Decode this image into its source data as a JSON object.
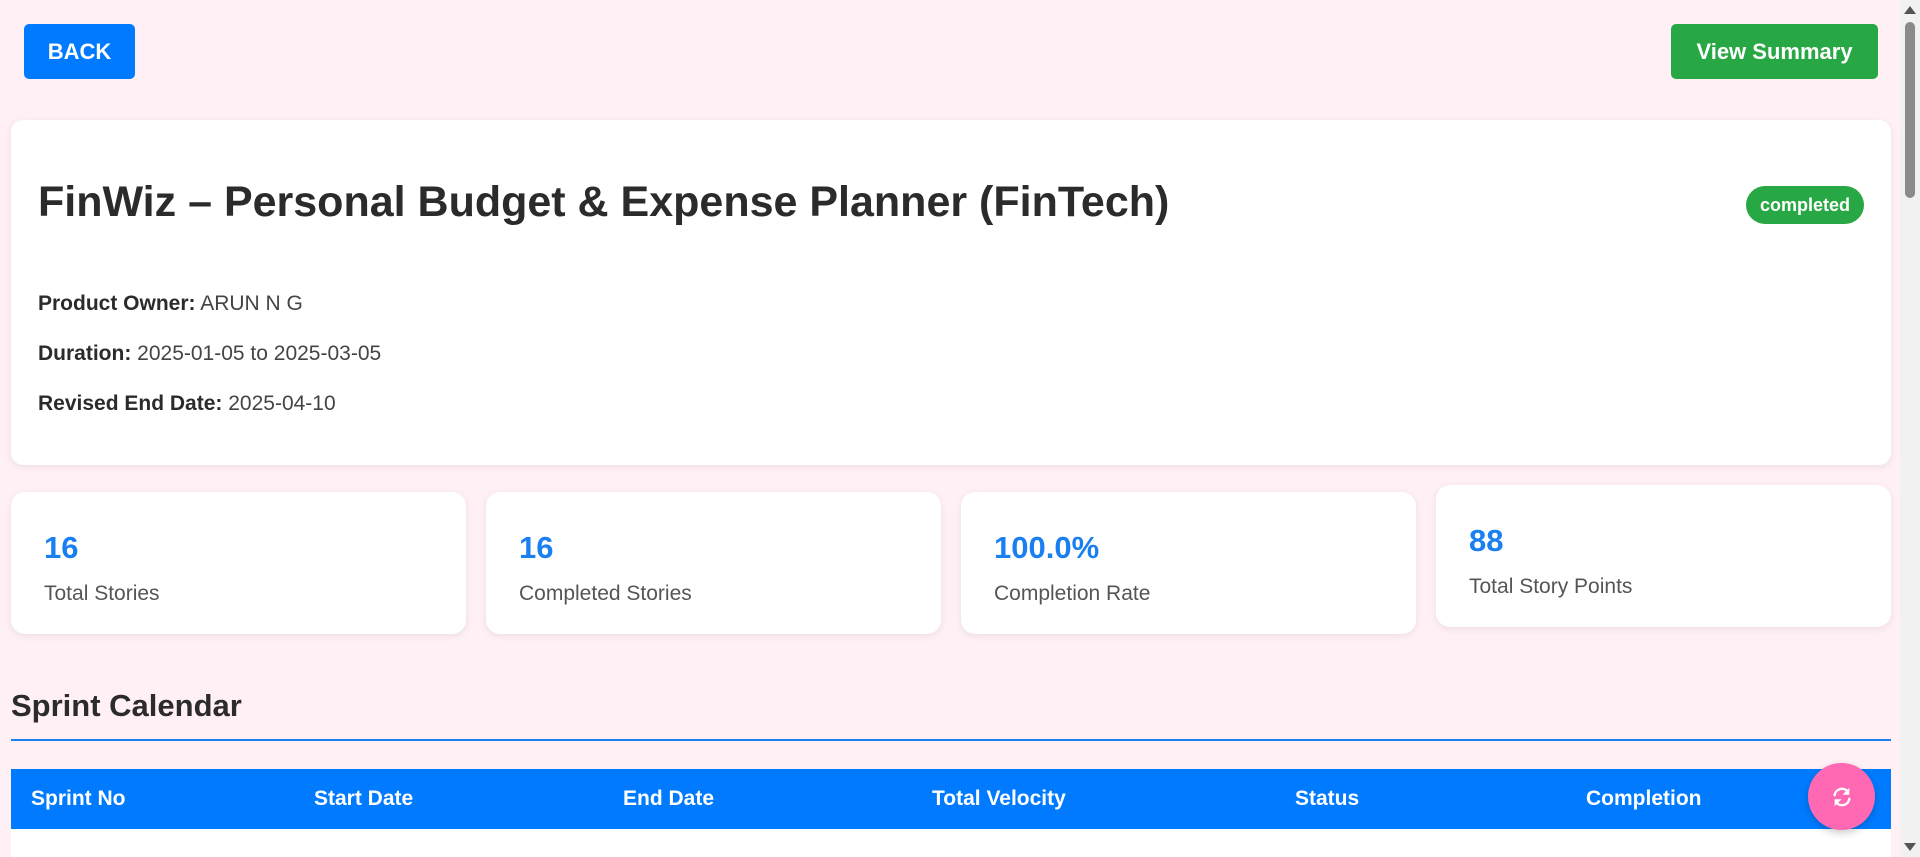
{
  "toolbar": {
    "back_label": "BACK",
    "summary_label": "View Summary"
  },
  "project": {
    "title": "FinWiz – Personal Budget & Expense Planner (FinTech)",
    "status": "completed",
    "product_owner_label": "Product Owner:",
    "product_owner": "ARUN N G",
    "duration_label": "Duration:",
    "duration": "2025-01-05 to 2025-03-05",
    "revised_end_label": "Revised End Date:",
    "revised_end": "2025-04-10"
  },
  "stats": [
    {
      "value": "16",
      "label": "Total Stories"
    },
    {
      "value": "16",
      "label": "Completed Stories"
    },
    {
      "value": "100.0%",
      "label": "Completion Rate"
    },
    {
      "value": "88",
      "label": "Total Story Points"
    }
  ],
  "sprint_calendar": {
    "title": "Sprint Calendar",
    "columns": [
      "Sprint No",
      "Start Date",
      "End Date",
      "Total Velocity",
      "Status",
      "Completion"
    ]
  },
  "colors": {
    "primary": "#007bff",
    "success": "#28a745",
    "fab": "#ff69b4",
    "background": "#fff0f5"
  },
  "icons": {
    "fab": "refresh-icon"
  }
}
